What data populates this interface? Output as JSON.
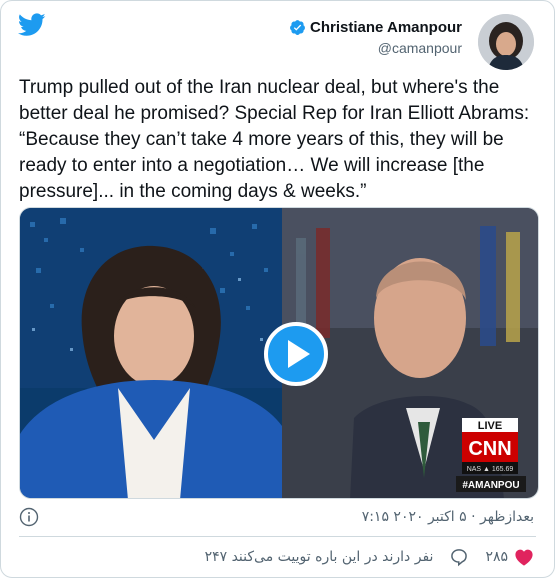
{
  "tweet": {
    "author": {
      "name": "Christiane Amanpour",
      "handle": "@camanpour"
    },
    "text": "Trump pulled out of the Iran nuclear deal, but where's the better deal he promised? Special Rep for Iran Elliott Abrams: “Because they can’t take 4 more years of this, they will be ready to enter into a negotiation… We will increase [the pressure]... in the coming days & weeks.”",
    "media": {
      "live_label": "LIVE",
      "network": "CNN",
      "ticker": "NAS ▲ 165.69",
      "show_tag": "#AMANPOU"
    },
    "timestamp": "۷:۱۵ بعدازظهر · ۵ اکتبر ۲۰۲۰",
    "likes_count": "۲۸۵",
    "replies_text": "۲۴۷ نفر دارند در این باره توییت می‌کنند"
  },
  "colors": {
    "brand_blue": "#1d9bf0",
    "like_red": "#e0245e",
    "secondary_text": "#536471"
  },
  "icons": [
    "twitter-bird-icon",
    "verified-badge-icon",
    "play-icon",
    "info-icon",
    "heart-icon",
    "comment-icon"
  ]
}
